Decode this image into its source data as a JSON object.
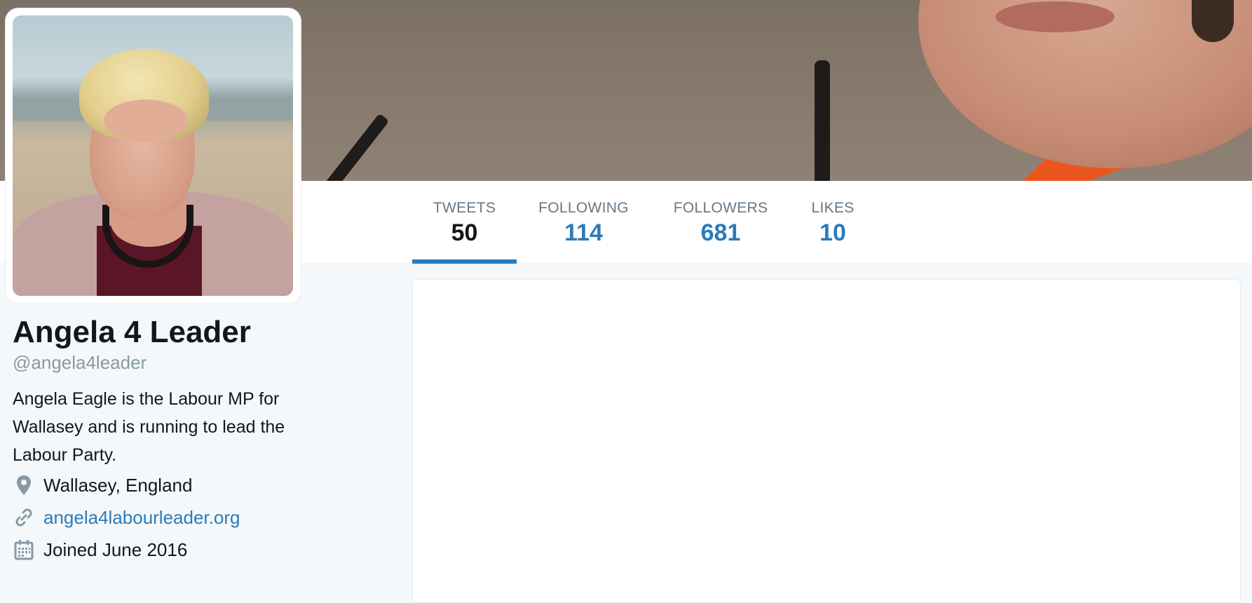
{
  "profile": {
    "name": "Angela 4 Leader",
    "handle": "@angela4leader",
    "bio": "Angela Eagle is the Labour MP for Wallasey and is running to lead the Labour Party.",
    "location": "Wallasey, England",
    "website": "angela4labourleader.org",
    "joined": "Joined June 2016"
  },
  "nav": {
    "items": [
      {
        "label": "TWEETS",
        "value": "50",
        "active": true
      },
      {
        "label": "FOLLOWING",
        "value": "114",
        "active": false
      },
      {
        "label": "FOLLOWERS",
        "value": "681",
        "active": false
      },
      {
        "label": "LIKES",
        "value": "10",
        "active": false
      }
    ]
  },
  "icons": {
    "location": "map-pin-icon",
    "website": "link-icon",
    "joined": "calendar-icon"
  },
  "colors": {
    "accent": "#2b7bb9",
    "background": "#f5f8fa",
    "muted_text": "#657786",
    "handle_text": "#8899a6"
  }
}
